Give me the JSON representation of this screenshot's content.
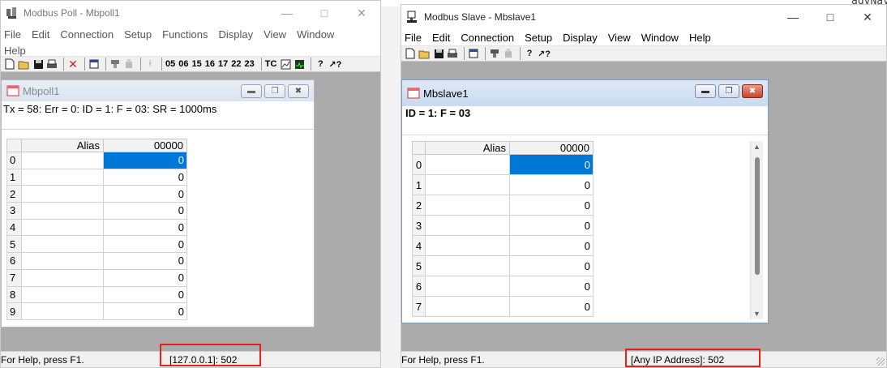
{
  "background": {
    "code_text": "agvNavigation start"
  },
  "poll": {
    "title": "Modbus Poll - Mbpoll1",
    "menu": [
      "File",
      "Edit",
      "Connection",
      "Setup",
      "Functions",
      "Display",
      "View",
      "Window",
      "Help"
    ],
    "toolbar_codes": [
      "05",
      "06",
      "15",
      "16",
      "17",
      "22",
      "23"
    ],
    "toolbar_tc": "TC",
    "child": {
      "title": "Mbpoll1",
      "summary": "Tx = 58: Err = 0: ID = 1: F = 03: SR = 1000ms",
      "col_alias": "Alias",
      "col_value": "00000",
      "rows": [
        {
          "idx": "0",
          "alias": "",
          "value": "0"
        },
        {
          "idx": "1",
          "alias": "",
          "value": "0"
        },
        {
          "idx": "2",
          "alias": "",
          "value": "0"
        },
        {
          "idx": "3",
          "alias": "",
          "value": "0"
        },
        {
          "idx": "4",
          "alias": "",
          "value": "0"
        },
        {
          "idx": "5",
          "alias": "",
          "value": "0"
        },
        {
          "idx": "6",
          "alias": "",
          "value": "0"
        },
        {
          "idx": "7",
          "alias": "",
          "value": "0"
        },
        {
          "idx": "8",
          "alias": "",
          "value": "0"
        },
        {
          "idx": "9",
          "alias": "",
          "value": "0"
        }
      ]
    },
    "status_help": "For Help, press F1.",
    "status_conn": "[127.0.0.1]: 502"
  },
  "slave": {
    "title": "Modbus Slave - Mbslave1",
    "menu": [
      "File",
      "Edit",
      "Connection",
      "Setup",
      "Display",
      "View",
      "Window",
      "Help"
    ],
    "child": {
      "title": "Mbslave1",
      "summary": "ID = 1: F = 03",
      "col_alias": "Alias",
      "col_value": "00000",
      "rows": [
        {
          "idx": "0",
          "alias": "",
          "value": "0"
        },
        {
          "idx": "1",
          "alias": "",
          "value": "0"
        },
        {
          "idx": "2",
          "alias": "",
          "value": "0"
        },
        {
          "idx": "3",
          "alias": "",
          "value": "0"
        },
        {
          "idx": "4",
          "alias": "",
          "value": "0"
        },
        {
          "idx": "5",
          "alias": "",
          "value": "0"
        },
        {
          "idx": "6",
          "alias": "",
          "value": "0"
        },
        {
          "idx": "7",
          "alias": "",
          "value": "0"
        }
      ]
    },
    "status_help": "For Help, press F1.",
    "status_conn": "[Any IP Address]: 502"
  },
  "colors": {
    "highlight_box": "#e8211b",
    "selected_cell": "#0078d7"
  }
}
